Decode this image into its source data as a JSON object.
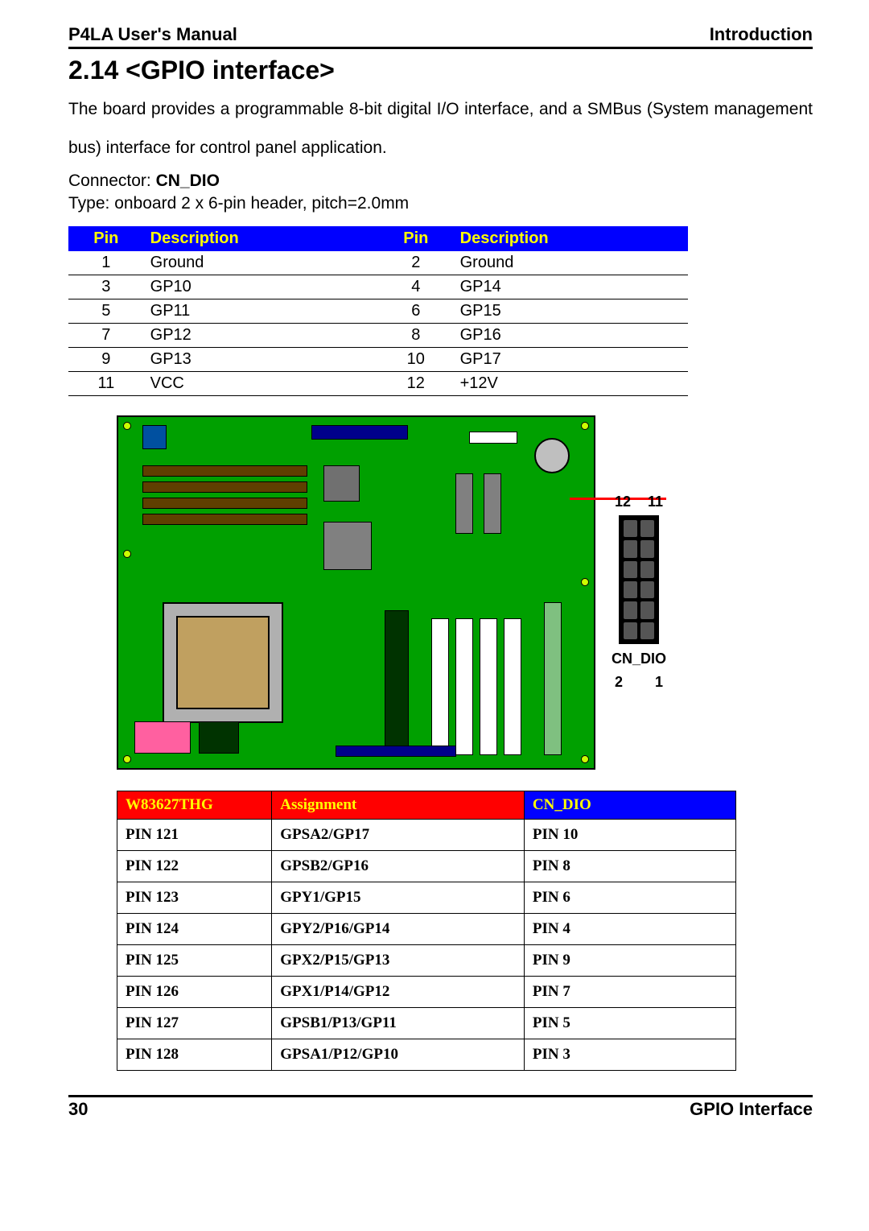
{
  "header": {
    "left": "P4LA User's Manual",
    "right": "Introduction"
  },
  "title": "2.14 <GPIO interface>",
  "paragraph": "The board provides a programmable 8-bit digital I/O interface, and a SMBus (System management bus) interface for control panel application.",
  "connector": {
    "label": "Connector: ",
    "value": "CN_DIO"
  },
  "type_line": "Type: onboard 2 x 6-pin header, pitch=2.0mm",
  "table1": {
    "headers": {
      "pin": "Pin",
      "desc": "Description"
    },
    "rows": [
      {
        "pa": "1",
        "da": "Ground",
        "pb": "2",
        "db": "Ground"
      },
      {
        "pa": "3",
        "da": "GP10",
        "pb": "4",
        "db": "GP14"
      },
      {
        "pa": "5",
        "da": "GP11",
        "pb": "6",
        "db": "GP15"
      },
      {
        "pa": "7",
        "da": "GP12",
        "pb": "8",
        "db": "GP16"
      },
      {
        "pa": "9",
        "da": "GP13",
        "pb": "10",
        "db": "GP17"
      },
      {
        "pa": "11",
        "da": "VCC",
        "pb": "12",
        "db": "+12V"
      }
    ]
  },
  "pinout": {
    "top_left": "12",
    "top_right": "11",
    "name": "CN_DIO",
    "bot_left": "2",
    "bot_right": "1"
  },
  "table2": {
    "headers": {
      "c1": "W83627THG",
      "c2": "Assignment",
      "c3": "CN_DIO"
    },
    "rows": [
      {
        "c1": "PIN 121",
        "c2": "GPSA2/GP17",
        "c3": "PIN 10"
      },
      {
        "c1": "PIN 122",
        "c2": "GPSB2/GP16",
        "c3": "PIN 8"
      },
      {
        "c1": "PIN 123",
        "c2": "GPY1/GP15",
        "c3": "PIN 6"
      },
      {
        "c1": "PIN 124",
        "c2": "GPY2/P16/GP14",
        "c3": "PIN 4"
      },
      {
        "c1": "PIN 125",
        "c2": "GPX2/P15/GP13",
        "c3": "PIN 9"
      },
      {
        "c1": "PIN 126",
        "c2": "GPX1/P14/GP12",
        "c3": "PIN 7"
      },
      {
        "c1": "PIN 127",
        "c2": "GPSB1/P13/GP11",
        "c3": "PIN 5"
      },
      {
        "c1": "PIN 128",
        "c2": "GPSA1/P12/GP10",
        "c3": "PIN 3"
      }
    ]
  },
  "footer": {
    "left": "30",
    "right": "GPIO  Interface"
  }
}
